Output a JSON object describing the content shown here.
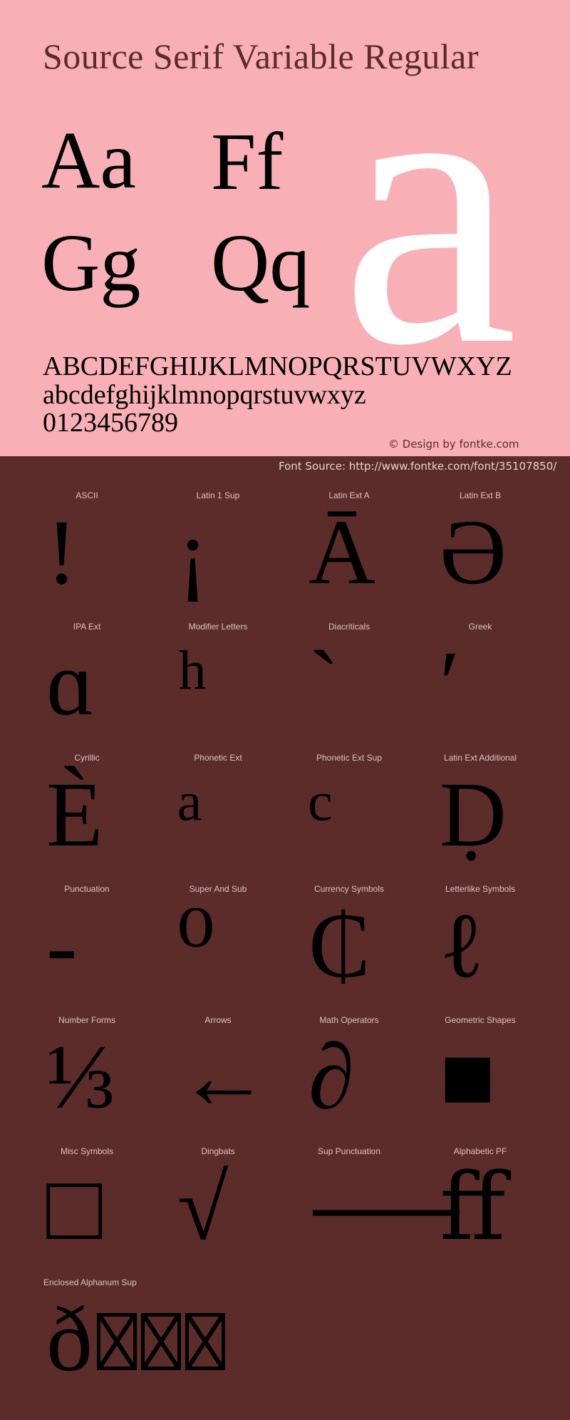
{
  "header": {
    "title": "Source Serif Variable Regular",
    "pairs": [
      "Aa",
      "Ff",
      "Gg",
      "Qq"
    ],
    "hero_glyph": "a",
    "uppercase": "ABCDEFGHIJKLMNOPQRSTUVWXYZ",
    "lowercase": "abcdefghijklmnopqrstuvwxyz",
    "digits": "0123456789",
    "credit": "© Design by fontke.com"
  },
  "source_line": "Font Source: http://www.fontke.com/font/35107850/",
  "colors": {
    "header_bg": "#f8b0b6",
    "body_bg": "#5b2c29",
    "title": "#5b2c29",
    "hero_glyph": "#ffffff",
    "label": "#dcc4c4",
    "glyph": "#000000"
  },
  "blocks": [
    {
      "label": "ASCII",
      "glyph": "!"
    },
    {
      "label": "Latin 1 Sup",
      "glyph": "¡"
    },
    {
      "label": "Latin Ext A",
      "glyph": "Ā"
    },
    {
      "label": "Latin Ext B",
      "glyph": "Ə"
    },
    {
      "label": "IPA Ext",
      "glyph": "ɑ"
    },
    {
      "label": "Modifier Letters",
      "glyph": "ʰ"
    },
    {
      "label": "Diacriticals",
      "glyph": "`"
    },
    {
      "label": "Greek",
      "glyph": "ʹ"
    },
    {
      "label": "Cyrillic",
      "glyph": "Ѐ"
    },
    {
      "label": "Phonetic Ext",
      "glyph": "ᵃ"
    },
    {
      "label": "Phonetic Ext Sup",
      "glyph": "ᶜ"
    },
    {
      "label": "Latin Ext Additional",
      "glyph": "Ḍ"
    },
    {
      "label": "Punctuation",
      "glyph": "‐"
    },
    {
      "label": "Super And Sub",
      "glyph": "⁰"
    },
    {
      "label": "Currency Symbols",
      "glyph": "₵"
    },
    {
      "label": "Letterlike Symbols",
      "glyph": "ℓ"
    },
    {
      "label": "Number Forms",
      "glyph": "⅓"
    },
    {
      "label": "Arrows",
      "glyph": "←"
    },
    {
      "label": "Math Operators",
      "glyph": "∂"
    },
    {
      "label": "Geometric Shapes",
      "glyph": "■"
    },
    {
      "label": "Misc Symbols",
      "glyph": "□"
    },
    {
      "label": "Dingbats",
      "glyph": "√"
    },
    {
      "label": "Sup Punctuation",
      "glyph": "⸺"
    },
    {
      "label": "Alphabetic PF",
      "glyph": "ﬀ"
    },
    {
      "label": "Enclosed Alphanum Sup",
      "glyph": "ð",
      "missing_glyph_boxes": 3
    }
  ]
}
